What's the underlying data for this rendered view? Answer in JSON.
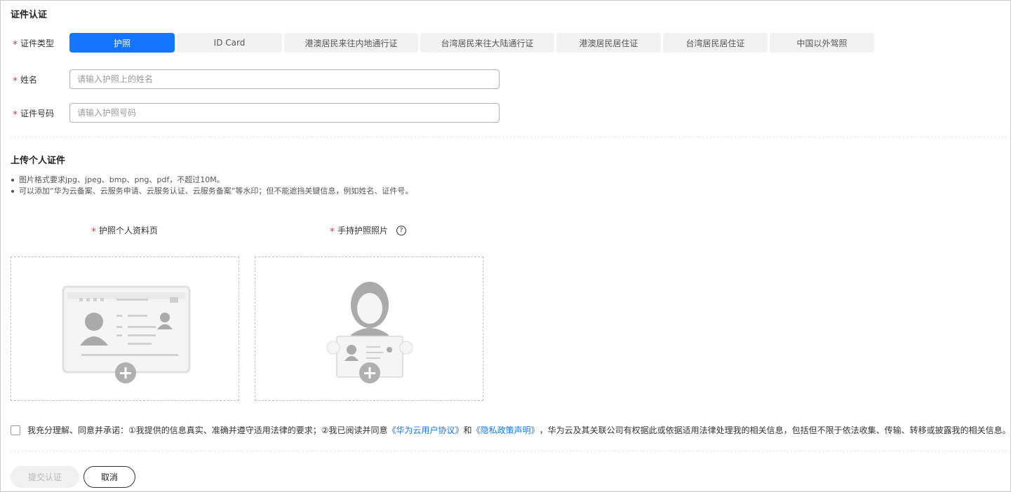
{
  "section1_title": "证件认证",
  "fields": {
    "required_mark": "*",
    "doc_type_label": "证件类型",
    "name_label": "姓名",
    "id_number_label": "证件号码",
    "name_placeholder": "请输入护照上的姓名",
    "id_number_placeholder": "请输入护照号码"
  },
  "doc_types": [
    {
      "label": "护照",
      "active": true
    },
    {
      "label": "ID Card",
      "active": false
    },
    {
      "label": "港澳居民来往内地通行证",
      "active": false
    },
    {
      "label": "台湾居民来往大陆通行证",
      "active": false
    },
    {
      "label": "港澳居民居住证",
      "active": false
    },
    {
      "label": "台湾居民居住证",
      "active": false
    },
    {
      "label": "中国以外驾照",
      "active": false
    }
  ],
  "section2_title": "上传个人证件",
  "notes": [
    "图片格式要求jpg、jpeg、bmp、png、pdf，不超过10M。",
    "可以添加“华为云备案、云服务申请、云服务认证、云服务备案”等水印；但不能遮挡关键信息，例如姓名、证件号。"
  ],
  "uploads": {
    "passport_page_label": "护照个人资料页",
    "handheld_label": "手持护照照片",
    "help_glyph": "?"
  },
  "agreement": {
    "text_before": "我充分理解、同意并承诺：①我提供的信息真实、准确并遵守适用法律的要求；②我已阅读并同意",
    "link1": "《华为云用户协议》",
    "text_mid": "和",
    "link2": "《隐私政策声明》",
    "text_after": "，华为云及其关联公司有权据此或依据适用法律处理我的相关信息，包括但不限于依法收集、传输、转移或披露我的相关信息。"
  },
  "buttons": {
    "submit": "提交认证",
    "cancel": "取消"
  },
  "colors": {
    "accent": "#1476ff",
    "required": "#e63a3a"
  }
}
